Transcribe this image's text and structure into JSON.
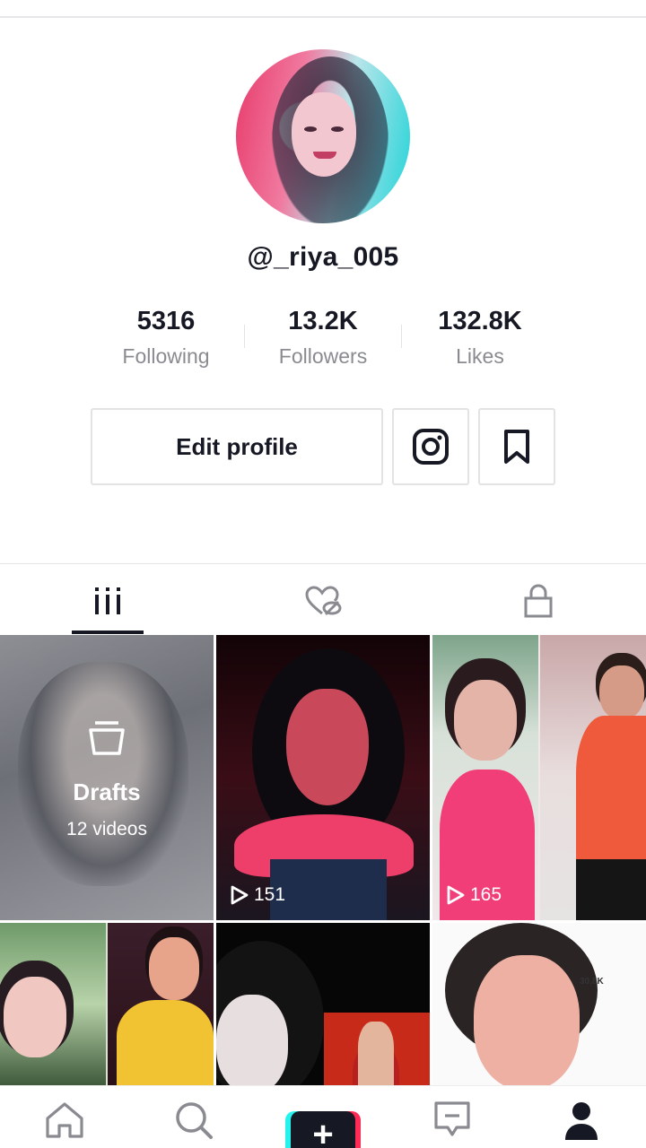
{
  "profile": {
    "username": "@_riya_005",
    "avatar_icon": "profile-photo"
  },
  "stats": {
    "following": {
      "value": "5316",
      "label": "Following"
    },
    "followers": {
      "value": "13.2K",
      "label": "Followers"
    },
    "likes": {
      "value": "132.8K",
      "label": "Likes"
    }
  },
  "actions": {
    "edit_label": "Edit profile",
    "instagram_icon": "instagram-icon",
    "bookmark_icon": "bookmark-icon"
  },
  "tabs": [
    {
      "icon": "videos-grid-icon",
      "active": true
    },
    {
      "icon": "liked-hidden-icon",
      "active": false
    },
    {
      "icon": "lock-icon",
      "active": false
    }
  ],
  "grid": {
    "drafts": {
      "title": "Drafts",
      "count": "12 videos"
    },
    "videos": [
      {
        "views": "151"
      },
      {
        "views": "165"
      }
    ],
    "overlay_text": "30.8K"
  },
  "bottom_nav": [
    {
      "icon": "home-icon"
    },
    {
      "icon": "search-icon"
    },
    {
      "icon": "create-plus-icon",
      "label": "+"
    },
    {
      "icon": "inbox-icon"
    },
    {
      "icon": "profile-icon",
      "active": true
    }
  ],
  "colors": {
    "accent_cyan": "#25f4ee",
    "accent_red": "#fe2c55",
    "text_primary": "#161823",
    "text_secondary": "#8a8b91"
  }
}
